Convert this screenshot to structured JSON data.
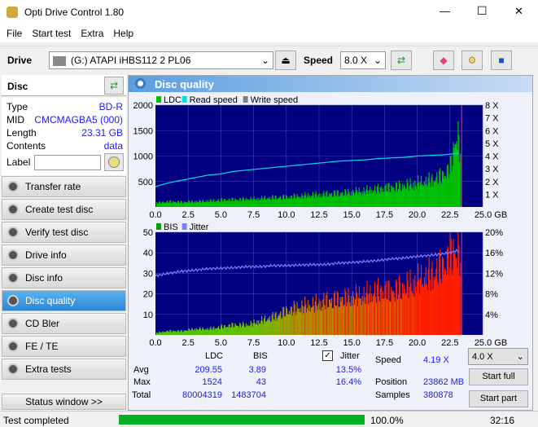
{
  "window": {
    "title": "Opti Drive Control 1.80",
    "minimize": "—",
    "maximize": "☐",
    "close": "✕"
  },
  "menu": [
    "File",
    "Start test",
    "Extra",
    "Help"
  ],
  "toolbar": {
    "drive_label": "Drive",
    "drive_value": "(G:)   ATAPI iHBS112   2 PL06",
    "speed_label": "Speed",
    "speed_value": "8.0 X"
  },
  "disc": {
    "title": "Disc",
    "rows": [
      {
        "k": "Type",
        "v": "BD-R"
      },
      {
        "k": "MID",
        "v": "CMCMAGBA5 (000)"
      },
      {
        "k": "Length",
        "v": "23.31 GB"
      },
      {
        "k": "Contents",
        "v": "data"
      }
    ],
    "label_label": "Label",
    "label_value": ""
  },
  "nav": [
    {
      "label": "Transfer rate"
    },
    {
      "label": "Create test disc"
    },
    {
      "label": "Verify test disc"
    },
    {
      "label": "Drive info"
    },
    {
      "label": "Disc info"
    },
    {
      "label": "Disc quality",
      "active": true
    },
    {
      "label": "CD Bler"
    },
    {
      "label": "FE / TE"
    },
    {
      "label": "Extra tests"
    }
  ],
  "status_window": "Status window >>",
  "panel_title": "Disc quality",
  "colors": {
    "ldc": "#00c000",
    "read": "#00e0e0",
    "write": "#808080",
    "bis": "#00a000",
    "jitter": "#8080ff",
    "plot_bg": "#000080",
    "grid": "#4040c0"
  },
  "chart_data": [
    {
      "type": "bar",
      "legend": [
        "LDC",
        "Read speed",
        "Write speed"
      ],
      "xlim": [
        0,
        25
      ],
      "ylim": [
        0,
        2000
      ],
      "y2lim": [
        0,
        8
      ],
      "xticks": [
        "0.0",
        "2.5",
        "5.0",
        "7.5",
        "10.0",
        "12.5",
        "15.0",
        "17.5",
        "20.0",
        "22.5",
        "25.0 GB"
      ],
      "yticks": [
        "500",
        "1000",
        "1500",
        "2000"
      ],
      "y2ticks": [
        "1 X",
        "2 X",
        "3 X",
        "4 X",
        "5 X",
        "6 X",
        "7 X",
        "8 X"
      ],
      "x": [
        0,
        1,
        2,
        3,
        4,
        5,
        6,
        7,
        8,
        9,
        10,
        11,
        12,
        13,
        14,
        15,
        16,
        17,
        18,
        19,
        20,
        21,
        22,
        22.5,
        23,
        23.3
      ],
      "ldc": [
        80,
        110,
        100,
        110,
        120,
        140,
        150,
        160,
        170,
        190,
        200,
        220,
        240,
        260,
        280,
        300,
        330,
        360,
        400,
        430,
        480,
        540,
        650,
        800,
        1524,
        1100
      ],
      "read_speed": [
        1.6,
        1.9,
        2.1,
        2.3,
        2.5,
        2.6,
        2.8,
        2.9,
        3.0,
        3.1,
        3.2,
        3.3,
        3.4,
        3.5,
        3.6,
        3.65,
        3.7,
        3.8,
        3.85,
        3.9,
        4.0,
        4.05,
        4.1,
        4.15,
        4.2,
        4.2
      ]
    },
    {
      "type": "bar",
      "legend": [
        "BIS",
        "Jitter"
      ],
      "xlim": [
        0,
        25
      ],
      "ylim": [
        0,
        50
      ],
      "y2lim": [
        0,
        20
      ],
      "xticks": [
        "0.0",
        "2.5",
        "5.0",
        "7.5",
        "10.0",
        "12.5",
        "15.0",
        "17.5",
        "20.0",
        "22.5",
        "25.0 GB"
      ],
      "yticks": [
        "10",
        "20",
        "30",
        "40",
        "50"
      ],
      "y2ticks": [
        "4%",
        "8%",
        "12%",
        "16%",
        "20%"
      ],
      "x": [
        0,
        1,
        2,
        3,
        4,
        5,
        6,
        7,
        8,
        9,
        10,
        11,
        12,
        13,
        14,
        15,
        16,
        17,
        18,
        19,
        20,
        21,
        22,
        22.5,
        23,
        23.3
      ],
      "bis": [
        1,
        2,
        2,
        3,
        3,
        4,
        5,
        5,
        7,
        9,
        12,
        14,
        15,
        17,
        18,
        19,
        20,
        22,
        22,
        24,
        27,
        30,
        35,
        40,
        43,
        38
      ],
      "jitter": [
        11.5,
        12.0,
        12.4,
        12.6,
        12.9,
        13.0,
        13.1,
        13.3,
        13.3,
        13.5,
        13.5,
        13.6,
        13.7,
        13.7,
        14.0,
        14.1,
        14.3,
        14.5,
        14.8,
        15.0,
        15.3,
        15.5,
        15.8,
        16.0,
        16.4,
        16.2
      ]
    }
  ],
  "stats": {
    "h_ldc": "LDC",
    "h_bis": "BIS",
    "jitter_label": "Jitter",
    "jitter_checked": true,
    "avg_label": "Avg",
    "avg_ldc": "209.55",
    "avg_bis": "3.89",
    "avg_jitter": "13.5%",
    "max_label": "Max",
    "max_ldc": "1524",
    "max_bis": "43",
    "max_jitter": "16.4%",
    "total_label": "Total",
    "total_ldc": "80004319",
    "total_bis": "1483704",
    "speed_label": "Speed",
    "speed_value": "4.19 X",
    "position_label": "Position",
    "position_value": "23862 MB",
    "samples_label": "Samples",
    "samples_value": "380878",
    "speed_select": "4.0 X",
    "start_full": "Start full",
    "start_part": "Start part"
  },
  "status": {
    "text": "Test completed",
    "progress": 100,
    "progress_text": "100.0%",
    "time": "32:16"
  }
}
